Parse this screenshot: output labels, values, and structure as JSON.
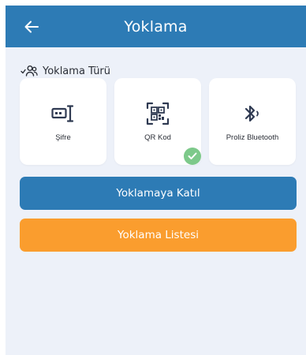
{
  "header": {
    "title": "Yoklama",
    "back_icon": "arrow-left-icon"
  },
  "section": {
    "label": "Yoklama Türü",
    "icon": "people-check-icon"
  },
  "options": [
    {
      "label": "Şifre",
      "icon": "password-keypad-icon"
    },
    {
      "label": "QR Kod",
      "icon": "qr-code-icon",
      "selected": true
    },
    {
      "label": "Proliz Bluetooth",
      "icon": "bluetooth-icon"
    }
  ],
  "buttons": {
    "join": "Yoklamaya Katıl",
    "list": "Yoklama Listesi"
  },
  "colors": {
    "primary": "#2d7bb5",
    "accent": "#fa9d2e",
    "background": "#edf1f9",
    "selected_check": "#7dc98a",
    "icon": "#2f3a52"
  }
}
